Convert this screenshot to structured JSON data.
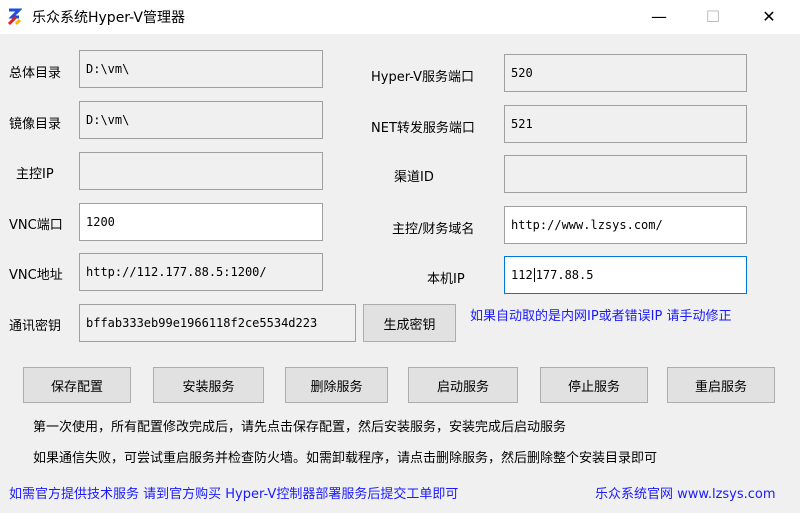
{
  "window": {
    "title": "乐众系统Hyper-V管理器",
    "minimize": "—",
    "maximize": "☐",
    "close": "✕"
  },
  "form": {
    "root_dir": {
      "label": "总体目录",
      "value": "D:\\vm\\"
    },
    "image_dir": {
      "label": "镜像目录",
      "value": "D:\\vm\\"
    },
    "master_ip": {
      "label": "主控IP",
      "value": ""
    },
    "vnc_port": {
      "label": "VNC端口",
      "value": "1200"
    },
    "vnc_addr": {
      "label": "VNC地址",
      "value": "http://112.177.88.5:1200/"
    },
    "secret": {
      "label": "通讯密钥",
      "value": "bffab333eb99e1966118f2ce5534d223"
    },
    "hyperv_port": {
      "label": "Hyper-V服务端口",
      "value": "520"
    },
    "net_port": {
      "label": "NET转发服务端口",
      "value": "521"
    },
    "channel_id": {
      "label": "渠道ID",
      "value": ""
    },
    "domain": {
      "label": "主控/财务域名",
      "value": "http://www.lzsys.com/"
    },
    "local_ip": {
      "label": "本机IP",
      "value_before_caret": "112",
      "value_after_caret": "177.88.5"
    }
  },
  "buttons": {
    "generate_key": "生成密钥",
    "save": "保存配置",
    "install": "安装服务",
    "delete": "删除服务",
    "start": "启动服务",
    "stop": "停止服务",
    "restart": "重启服务"
  },
  "notes": {
    "ip_hint": "如果自动取的是内网IP或者错误IP 请手动修正",
    "first_use": "第一次使用，所有配置修改完成后，请先点击保存配置，然后安装服务，安装完成后启动服务",
    "failure": "如果通信失败，可尝试重启服务并检查防火墙。如需卸载程序，请点击删除服务，然后删除整个安装目录即可",
    "support": "如需官方提供技术服务 请到官方购买 Hyper-V控制器部署服务后提交工单即可",
    "website": "乐众系统官网 www.lzsys.com"
  },
  "colors": {
    "link_blue": "#1a1aff",
    "focus_border": "#0078d7"
  }
}
